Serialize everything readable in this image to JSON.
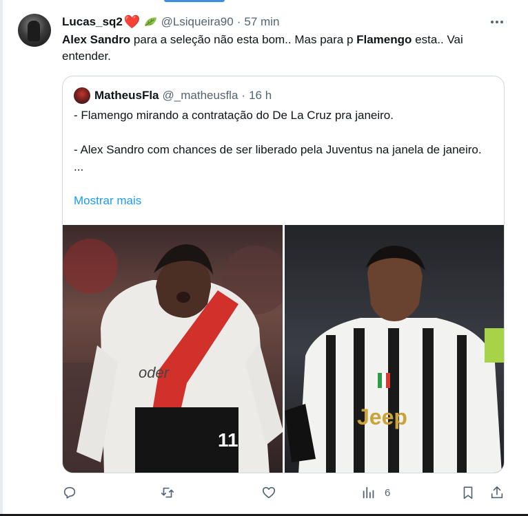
{
  "tweet": {
    "author_name": "Lucas_sq2",
    "author_emoji": "❤️",
    "handle": "@Lsiqueira90",
    "separator": "·",
    "time": "57 min",
    "text": {
      "part1_bold": "Alex Sandro",
      "part2": " para a seleção não esta bom.. Mas para p ",
      "part3_bold": "Flamengo",
      "part4": " esta.. Vai entender."
    }
  },
  "quoted": {
    "author_name": "MatheusFla",
    "handle": "@_matheusfla",
    "separator": "·",
    "time": "16 h",
    "lines": [
      "- Flamengo mirando a contratação do De La Cruz pra janeiro.",
      "- Alex Sandro com chances de ser liberado pela Juventus na janela de janeiro.",
      "..."
    ],
    "show_more": "Mostrar mais",
    "images": {
      "left": {
        "jersey_text": "oder",
        "number": "11"
      },
      "right": {
        "jersey_text": "Jeep"
      }
    }
  },
  "actions": {
    "views_count": "6"
  },
  "colors": {
    "text": "#0f1419",
    "secondary": "#536471",
    "link": "#1d9bf0",
    "border": "#cfd9de",
    "heart": "#e0245e"
  }
}
